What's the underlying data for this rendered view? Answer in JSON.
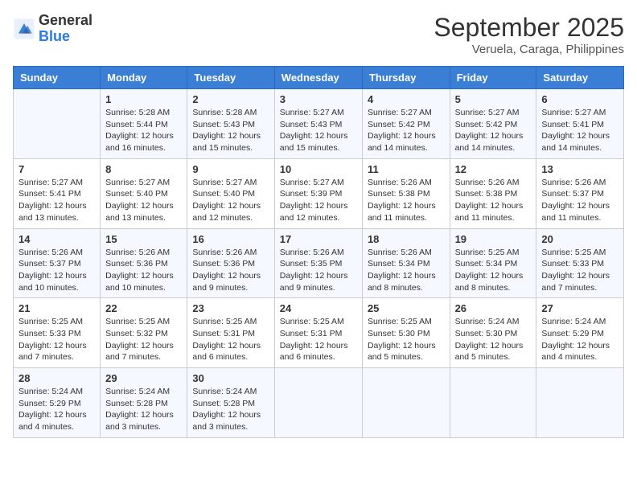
{
  "header": {
    "logo_line1": "General",
    "logo_line2": "Blue",
    "month": "September 2025",
    "location": "Veruela, Caraga, Philippines"
  },
  "weekdays": [
    "Sunday",
    "Monday",
    "Tuesday",
    "Wednesday",
    "Thursday",
    "Friday",
    "Saturday"
  ],
  "weeks": [
    [
      {
        "day": "",
        "info": ""
      },
      {
        "day": "1",
        "info": "Sunrise: 5:28 AM\nSunset: 5:44 PM\nDaylight: 12 hours\nand 16 minutes."
      },
      {
        "day": "2",
        "info": "Sunrise: 5:28 AM\nSunset: 5:43 PM\nDaylight: 12 hours\nand 15 minutes."
      },
      {
        "day": "3",
        "info": "Sunrise: 5:27 AM\nSunset: 5:43 PM\nDaylight: 12 hours\nand 15 minutes."
      },
      {
        "day": "4",
        "info": "Sunrise: 5:27 AM\nSunset: 5:42 PM\nDaylight: 12 hours\nand 14 minutes."
      },
      {
        "day": "5",
        "info": "Sunrise: 5:27 AM\nSunset: 5:42 PM\nDaylight: 12 hours\nand 14 minutes."
      },
      {
        "day": "6",
        "info": "Sunrise: 5:27 AM\nSunset: 5:41 PM\nDaylight: 12 hours\nand 14 minutes."
      }
    ],
    [
      {
        "day": "7",
        "info": "Sunrise: 5:27 AM\nSunset: 5:41 PM\nDaylight: 12 hours\nand 13 minutes."
      },
      {
        "day": "8",
        "info": "Sunrise: 5:27 AM\nSunset: 5:40 PM\nDaylight: 12 hours\nand 13 minutes."
      },
      {
        "day": "9",
        "info": "Sunrise: 5:27 AM\nSunset: 5:40 PM\nDaylight: 12 hours\nand 12 minutes."
      },
      {
        "day": "10",
        "info": "Sunrise: 5:27 AM\nSunset: 5:39 PM\nDaylight: 12 hours\nand 12 minutes."
      },
      {
        "day": "11",
        "info": "Sunrise: 5:26 AM\nSunset: 5:38 PM\nDaylight: 12 hours\nand 11 minutes."
      },
      {
        "day": "12",
        "info": "Sunrise: 5:26 AM\nSunset: 5:38 PM\nDaylight: 12 hours\nand 11 minutes."
      },
      {
        "day": "13",
        "info": "Sunrise: 5:26 AM\nSunset: 5:37 PM\nDaylight: 12 hours\nand 11 minutes."
      }
    ],
    [
      {
        "day": "14",
        "info": "Sunrise: 5:26 AM\nSunset: 5:37 PM\nDaylight: 12 hours\nand 10 minutes."
      },
      {
        "day": "15",
        "info": "Sunrise: 5:26 AM\nSunset: 5:36 PM\nDaylight: 12 hours\nand 10 minutes."
      },
      {
        "day": "16",
        "info": "Sunrise: 5:26 AM\nSunset: 5:36 PM\nDaylight: 12 hours\nand 9 minutes."
      },
      {
        "day": "17",
        "info": "Sunrise: 5:26 AM\nSunset: 5:35 PM\nDaylight: 12 hours\nand 9 minutes."
      },
      {
        "day": "18",
        "info": "Sunrise: 5:26 AM\nSunset: 5:34 PM\nDaylight: 12 hours\nand 8 minutes."
      },
      {
        "day": "19",
        "info": "Sunrise: 5:25 AM\nSunset: 5:34 PM\nDaylight: 12 hours\nand 8 minutes."
      },
      {
        "day": "20",
        "info": "Sunrise: 5:25 AM\nSunset: 5:33 PM\nDaylight: 12 hours\nand 7 minutes."
      }
    ],
    [
      {
        "day": "21",
        "info": "Sunrise: 5:25 AM\nSunset: 5:33 PM\nDaylight: 12 hours\nand 7 minutes."
      },
      {
        "day": "22",
        "info": "Sunrise: 5:25 AM\nSunset: 5:32 PM\nDaylight: 12 hours\nand 7 minutes."
      },
      {
        "day": "23",
        "info": "Sunrise: 5:25 AM\nSunset: 5:31 PM\nDaylight: 12 hours\nand 6 minutes."
      },
      {
        "day": "24",
        "info": "Sunrise: 5:25 AM\nSunset: 5:31 PM\nDaylight: 12 hours\nand 6 minutes."
      },
      {
        "day": "25",
        "info": "Sunrise: 5:25 AM\nSunset: 5:30 PM\nDaylight: 12 hours\nand 5 minutes."
      },
      {
        "day": "26",
        "info": "Sunrise: 5:24 AM\nSunset: 5:30 PM\nDaylight: 12 hours\nand 5 minutes."
      },
      {
        "day": "27",
        "info": "Sunrise: 5:24 AM\nSunset: 5:29 PM\nDaylight: 12 hours\nand 4 minutes."
      }
    ],
    [
      {
        "day": "28",
        "info": "Sunrise: 5:24 AM\nSunset: 5:29 PM\nDaylight: 12 hours\nand 4 minutes."
      },
      {
        "day": "29",
        "info": "Sunrise: 5:24 AM\nSunset: 5:28 PM\nDaylight: 12 hours\nand 3 minutes."
      },
      {
        "day": "30",
        "info": "Sunrise: 5:24 AM\nSunset: 5:28 PM\nDaylight: 12 hours\nand 3 minutes."
      },
      {
        "day": "",
        "info": ""
      },
      {
        "day": "",
        "info": ""
      },
      {
        "day": "",
        "info": ""
      },
      {
        "day": "",
        "info": ""
      }
    ]
  ]
}
